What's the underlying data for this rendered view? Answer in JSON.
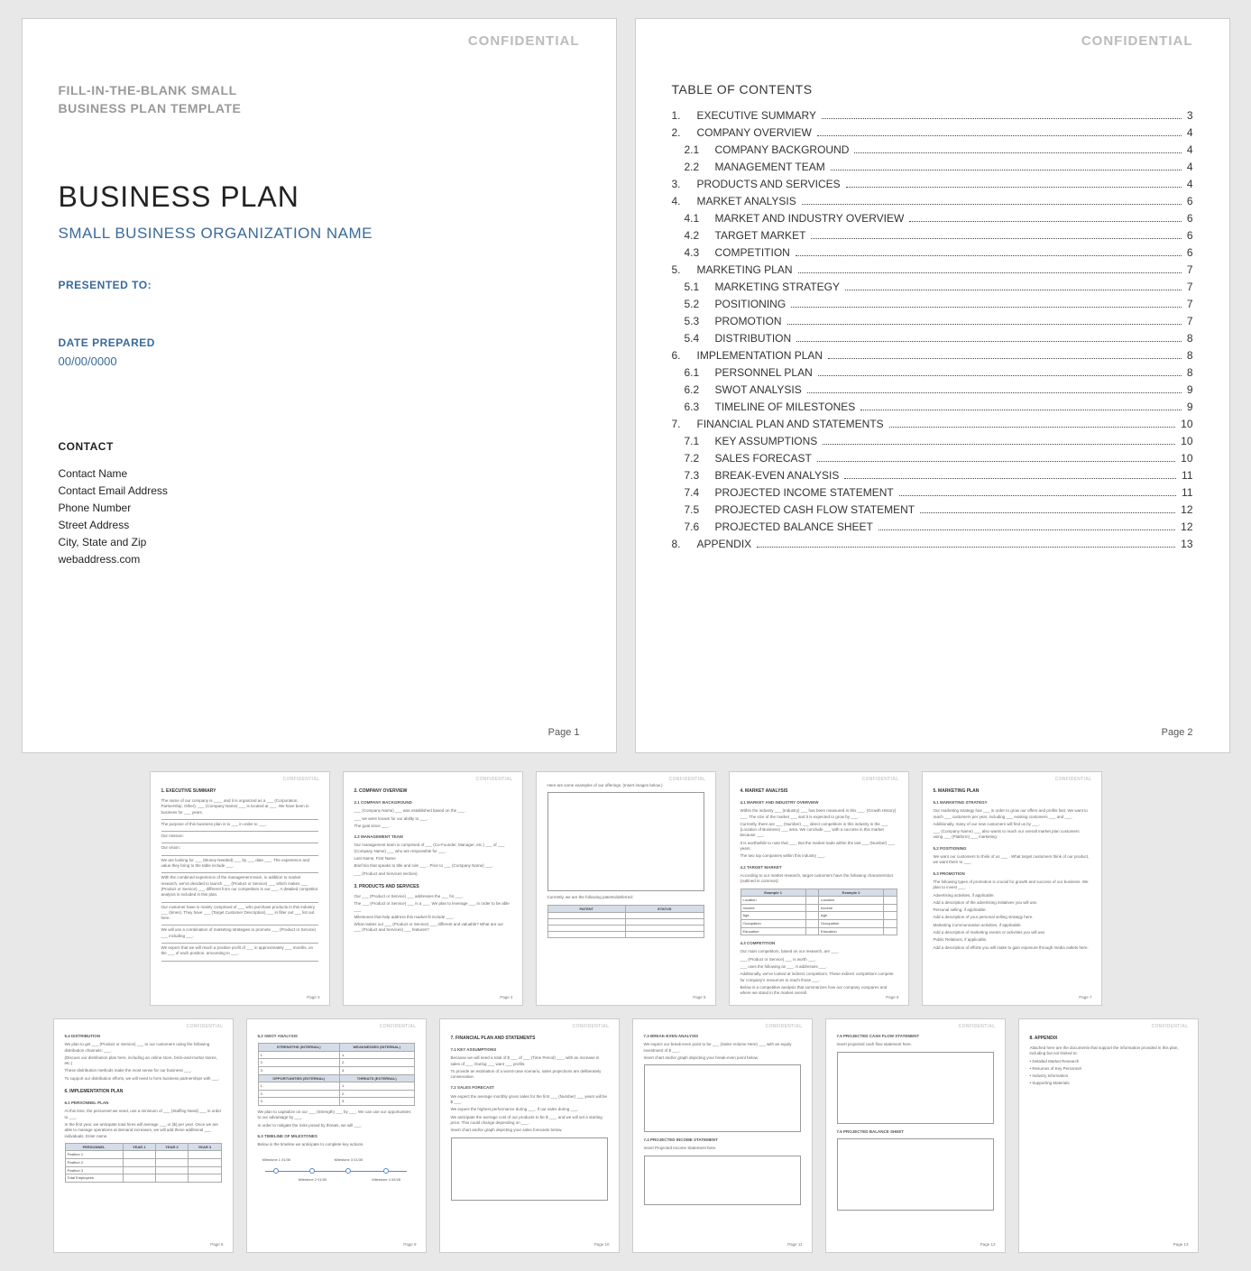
{
  "common": {
    "confidential": "CONFIDENTIAL",
    "page_prefix": "Page"
  },
  "page1": {
    "template_label_1": "FILL-IN-THE-BLANK SMALL",
    "template_label_2": "BUSINESS PLAN TEMPLATE",
    "title": "BUSINESS PLAN",
    "subtitle": "SMALL BUSINESS ORGANIZATION NAME",
    "presented_to_label": "PRESENTED TO:",
    "date_label": "DATE PREPARED",
    "date_value": "00/00/0000",
    "contact_heading": "CONTACT",
    "contact_name": "Contact Name",
    "contact_email": "Contact Email Address",
    "contact_phone": "Phone Number",
    "contact_street": "Street Address",
    "contact_city": "City, State and Zip",
    "contact_web": "webaddress.com",
    "page_num": "Page 1"
  },
  "page2": {
    "toc_title": "TABLE OF CONTENTS",
    "items": [
      {
        "num": "1.",
        "label": "EXECUTIVE SUMMARY",
        "pg": "3",
        "sub": false
      },
      {
        "num": "2.",
        "label": "COMPANY OVERVIEW",
        "pg": "4",
        "sub": false
      },
      {
        "num": "2.1",
        "label": "COMPANY BACKGROUND",
        "pg": "4",
        "sub": true
      },
      {
        "num": "2.2",
        "label": "MANAGEMENT TEAM",
        "pg": "4",
        "sub": true
      },
      {
        "num": "3.",
        "label": "PRODUCTS AND SERVICES",
        "pg": "4",
        "sub": false
      },
      {
        "num": "4.",
        "label": "MARKET ANALYSIS",
        "pg": "6",
        "sub": false
      },
      {
        "num": "4.1",
        "label": "MARKET AND INDUSTRY OVERVIEW",
        "pg": "6",
        "sub": true
      },
      {
        "num": "4.2",
        "label": "TARGET MARKET",
        "pg": "6",
        "sub": true
      },
      {
        "num": "4.3",
        "label": "COMPETITION",
        "pg": "6",
        "sub": true
      },
      {
        "num": "5.",
        "label": "MARKETING PLAN",
        "pg": "7",
        "sub": false
      },
      {
        "num": "5.1",
        "label": "MARKETING STRATEGY",
        "pg": "7",
        "sub": true
      },
      {
        "num": "5.2",
        "label": "POSITIONING",
        "pg": "7",
        "sub": true
      },
      {
        "num": "5.3",
        "label": "PROMOTION",
        "pg": "7",
        "sub": true
      },
      {
        "num": "5.4",
        "label": "DISTRIBUTION",
        "pg": "8",
        "sub": true
      },
      {
        "num": "6.",
        "label": "IMPLEMENTATION PLAN",
        "pg": "8",
        "sub": false
      },
      {
        "num": "6.1",
        "label": "PERSONNEL PLAN",
        "pg": "8",
        "sub": true
      },
      {
        "num": "6.2",
        "label": "SWOT ANALYSIS",
        "pg": "9",
        "sub": true
      },
      {
        "num": "6.3",
        "label": "TIMELINE OF MILESTONES",
        "pg": "9",
        "sub": true
      },
      {
        "num": "7.",
        "label": "FINANCIAL PLAN AND STATEMENTS",
        "pg": "10",
        "sub": false
      },
      {
        "num": "7.1",
        "label": "KEY ASSUMPTIONS",
        "pg": "10",
        "sub": true
      },
      {
        "num": "7.2",
        "label": "SALES FORECAST",
        "pg": "10",
        "sub": true
      },
      {
        "num": "7.3",
        "label": "BREAK-EVEN ANALYSIS",
        "pg": "11",
        "sub": true
      },
      {
        "num": "7.4",
        "label": "PROJECTED INCOME STATEMENT",
        "pg": "11",
        "sub": true
      },
      {
        "num": "7.5",
        "label": "PROJECTED CASH FLOW STATEMENT",
        "pg": "12",
        "sub": true
      },
      {
        "num": "7.6",
        "label": "PROJECTED BALANCE SHEET",
        "pg": "12",
        "sub": true
      },
      {
        "num": "8.",
        "label": "APPENDIX",
        "pg": "13",
        "sub": false
      }
    ],
    "page_num": "Page 2"
  },
  "thumbs": {
    "p3": {
      "h": "1.  EXECUTIVE SUMMARY",
      "body": [
        "The name of our company is ____ and it is organized as a ___ (Corporation, Partnership, Other). ___ (Company Name) ___ is located at ___. We have been in business for ___ years.",
        "The purpose of this business plan is to ___ in order to ___.",
        "Our mission:",
        "Our vision:",
        "We are looking for ___ (Money Needed) ___ by ___ date ___. The experience and value they bring to the table include ___.",
        "With the combined experience of the management team, in addition to market research, we've decided to launch ___ (Product or Service) ___ which makes ___ (Product or Service) ___ different from our competitors is our ___. A detailed competitor analysis is included in this plan.",
        "Our customer base is mainly comprised of ___ who purchase products in this industry ___ (times). They have ___ (Target Customer Description) ___ in filter out ___ list out here.",
        "We will use a combination of marketing strategies to promote ___ (Product or Service) ___ including ___.",
        "We expect that we will reach a positive profit of ___ in approximately ___ months, on the ___ of each position, amounting to ___."
      ],
      "pg": "Page 3"
    },
    "p4": {
      "h": "2.  COMPANY OVERVIEW",
      "s21": "2.1  COMPANY BACKGROUND",
      "s21_body": [
        "___ (Company Name) ___ was established based on the ___ .",
        "___ we were known for our ability to ___.",
        "The goal since ___."
      ],
      "s22": "2.2  MANAGEMENT TEAM",
      "s22_body": [
        "Our management team is comprised of ___ (Co-Founder, Manager, etc.) ___ of ___ (Company Name) ___ who are responsible for ___.",
        "Last Name, First Name",
        "Brief bio that speaks to title and role ___ . Prior to ___ (Company Name) ___.",
        "___ (Product and Services section)."
      ],
      "s3": "3.  PRODUCTS AND SERVICES",
      "s3_body": [
        "Our ___ (Product or Service) ___ addresses the ___ for ___.",
        "The ___ (Product or Service) ___ is a ___. We plan to leverage ___ in order to be able ___.",
        "Milestones that help address this market fit include ___.",
        "What makes our ___ (Product or Service) ___ different and valuable? What are our ___ (Product and Services) ___ features?"
      ],
      "pg": "Page 4"
    },
    "p5": {
      "intro": "Here are some examples of our offerings. (Insert images below.)",
      "patents": "Currently, we are the following patents/deferred:",
      "cols": [
        "PATENT",
        "STATUS"
      ],
      "pg": "Page 5"
    },
    "p6": {
      "h": "4.  MARKET ANALYSIS",
      "s41": "4.1  MARKET AND INDUSTRY OVERVIEW",
      "s41_body": [
        "Within the industry ___ (Industry) ___ has been measured in this ___. (Growth History) ___. The size of the market ___ and it is expected to grow by ___.",
        "Currently, there are ___ (Number) ___ direct competitors in this industry in the ___ (Location of Business) ___ area. We conclude ___ with a success in this market because ___.",
        "It is worthwhile to note that ___. But the market trade within the last ___ (Number) ___ years.",
        "The two top companies within this industry ___."
      ],
      "s42": "4.2  TARGET MARKET",
      "s42_body": "According to our market research, target customers have the following characteristics (outlined in common):",
      "example_cols": [
        "Example 1",
        "",
        "Example 2",
        ""
      ],
      "example_rows": [
        "Location",
        "Income",
        "Age",
        "Occupation",
        "Education"
      ],
      "s43": "4.3  COMPETITION",
      "s43_body": [
        "Our main competitors, based on our research, are ___.",
        "___ (Product or Service) ___ is worth ___.",
        "___ uses the following as ___. It addresses ___.",
        "Additionally, we've looked at indirect competitors. These indirect competitors compete for company's resources to reach those ___.",
        "Below is a competitive analysis that summarizes how our company compares and where we stand in the market overall."
      ],
      "pg": "Page 6"
    },
    "p7": {
      "h": "5.  MARKETING PLAN",
      "s51": "5.1  MARKETING STRATEGY",
      "s51_body": [
        "Our marketing strategy has ___ in order to grow our offers and profits fast. We want to reach ___ customers per year, including ___ existing customers ___ and ___.",
        "Additionally, many of our new customers will find us by ___.",
        "___ (Company Name) ___ also wants to reach our overall market plan customers using ___ (Platform) ___ marketing."
      ],
      "s52": "5.2  POSITIONING",
      "s52_body": [
        "We want our customers to think of us ___ . What target customers think of our product, we want them to ___."
      ],
      "s53": "5.3  PROMOTION",
      "s53_body": [
        "The following types of promotion is crucial for growth and success of our business. We plan to invest ___.",
        "Advertising activities, if applicable.",
        "Add a description of the advertising initiatives you will use.",
        "Personal selling, if applicable.",
        "Add a description of your personal selling strategy here.",
        "Marketing Communication activities, if applicable.",
        "Add a description of marketing events or activities you will use.",
        "Public Relations, if applicable.",
        "Add a description of efforts you will make to gain exposure through media outlets here."
      ],
      "pg": "Page 7"
    },
    "p8": {
      "s54": "5.4  DISTRIBUTION",
      "s54_body": [
        "We plan to get ___ (Product or Service) ___ to our customers using the following distribution channels: ___.",
        "(Discuss our distribution plan here, including an online store, brick-and-mortar stores, etc.)",
        "These distribution methods make the most sense for our business ___.",
        "To support our distribution efforts, we will need to form business partnerships with ___."
      ],
      "h6": "6.  IMPLEMENTATION PLAN",
      "s61": "6.1  PERSONNEL PLAN",
      "s61_body": [
        "At this time, the personnel we need, use a minimum of ___ (Staffing Need) ___ in order to ___.",
        "In the first year, we anticipate total hires will average ___ or ($) per year. Once we are able to manage operations at demand increases, we will add these additional ___ individuals. Enter name."
      ],
      "table_cols": [
        "PERSONNEL",
        "YEAR 1",
        "YEAR 2",
        "YEAR 3"
      ],
      "table_rows": [
        "Position 1",
        "Position 2",
        "Position 3",
        "Total Employees"
      ],
      "pg": "Page 8"
    },
    "p9": {
      "s62": "6.2  SWOT ANALYSIS",
      "swot": {
        "s": "STRENGTHS (INTERNAL)",
        "w": "WEAKNESSES (INTERNAL)",
        "o": "OPPORTUNITIES (EXTERNAL)",
        "t": "THREATS (EXTERNAL)",
        "rows": [
          "1.",
          "2.",
          "3."
        ]
      },
      "swot_body": [
        "We plan to capitalize on our ___ (Strength) ___ by ___. We can use our opportunities to our advantage by ___.",
        "In order to mitigate the risks posed by threats, we will ___."
      ],
      "s63": "6.3  TIMELINE OF MILESTONES",
      "s63_body": "Below is the timeline we anticipate to complete key actions.",
      "timeline": [
        {
          "label": "Milestone 1",
          "date": "01/30",
          "pos": 10
        },
        {
          "label": "Milestone 2",
          "date": "01/30",
          "pos": 33
        },
        {
          "label": "Milestone 3",
          "date": "01/30",
          "pos": 56
        },
        {
          "label": "Milestone 4",
          "date": "02/28",
          "pos": 80
        }
      ],
      "pg": "Page 9"
    },
    "p10": {
      "h": "7.  FINANCIAL PLAN AND STATEMENTS",
      "s71": "7.1  KEY ASSUMPTIONS",
      "s71_body": [
        "Because we will need a total of $ ___ of ___ (Time Period) ___, with an increase in sales of ___. During ___ want ___ profits.",
        "To provide an estimation of a worst-case scenario, sales projections are deliberately conservative."
      ],
      "s72": "7.2  SALES FORECAST",
      "s72_body": [
        "We expect the average monthly gross sales for the first ___ (Number) ___ years will be $ ___.",
        "We expect the highest performance during ___. If our sales during ___.",
        "We anticipate the average cost of our products to be $ ___, and we will set a starting price. This could change depending on ___."
      ],
      "s72_chart": "Insert chart and/or graph depicting your sales forecasts below.",
      "pg": "Page 10"
    },
    "p11": {
      "s73": "7.3  BREAK-EVEN ANALYSIS",
      "s73_body": [
        "We expect our break-even point to be ___ (Sales Volume Here) ___ with an equity investment of $ ___.",
        "Insert chart and/or graph depicting your break-even point below."
      ],
      "s74": "7.4  PROJECTED INCOME STATEMENT",
      "s74_body": "Insert Projected Income Statement here.",
      "pg": "Page 11"
    },
    "p12": {
      "s75": "7.5  PROJECTED CASH FLOW STATEMENT",
      "s75_body": "Insert projected cash flow statement here.",
      "s76": "7.6  PROJECTED BALANCE SHEET",
      "pg": "Page 12"
    },
    "p13": {
      "h": "8.  APPENDIX",
      "body": [
        "Attached here are the documents that support the information provided in this plan, including but not limited to:",
        "• Detailed Market Research",
        "• Resumes of Key Personnel",
        "• Industry Information",
        "• Supporting Materials"
      ],
      "pg": "Page 13"
    }
  }
}
